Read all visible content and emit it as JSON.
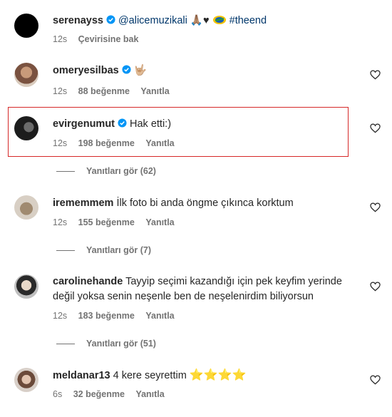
{
  "comments": [
    {
      "username": "serenayss",
      "mention": "@alicemuzikali",
      "emojis": "🙏🏽♥",
      "hashtag": "#theend",
      "time": "12s",
      "translate": "Çevirisine bak"
    },
    {
      "username": "omeryesilbas",
      "emoji": "🤟🏼",
      "time": "12s",
      "likes": "88 beğenme",
      "reply": "Yanıtla"
    },
    {
      "username": "evirgenumut",
      "text": "Hak etti:)",
      "time": "12s",
      "likes": "198 beğenme",
      "reply": "Yanıtla",
      "view_replies": "Yanıtları gör (62)"
    },
    {
      "username": "irememmem",
      "text": "İlk foto bi anda öngme çıkınca korktum",
      "time": "12s",
      "likes": "155 beğenme",
      "reply": "Yanıtla",
      "view_replies": "Yanıtları gör (7)"
    },
    {
      "username": "carolinehande",
      "text": "Tayyip seçimi kazandığı için pek keyfim yerinde değil yoksa senin neşenle ben de neşelenirdim biliyorsun",
      "time": "12s",
      "likes": "183 beğenme",
      "reply": "Yanıtla",
      "view_replies": "Yanıtları gör (51)"
    },
    {
      "username": "meldanar13",
      "text": "4 kere seyrettim",
      "stars": "⭐⭐⭐⭐",
      "time": "6s",
      "likes": "32 beğenme",
      "reply": "Yanıtla"
    }
  ],
  "colors": {
    "verified": "#0095f6",
    "highlight": "#d62828",
    "secondary_text": "#737373"
  },
  "icons": {
    "verified": "verified-badge-icon",
    "like": "heart-icon",
    "star": "star-icon"
  }
}
